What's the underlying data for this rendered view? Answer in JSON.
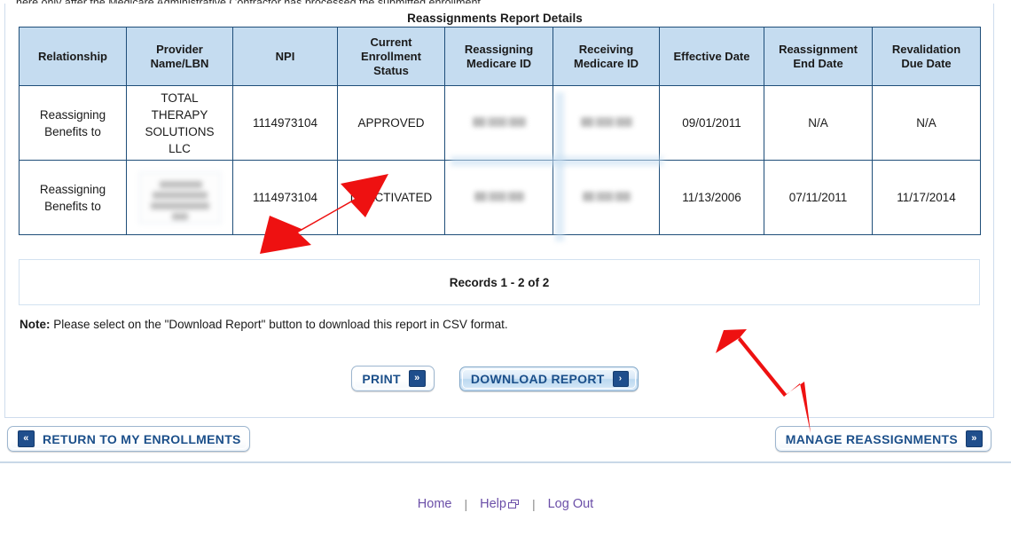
{
  "page": {
    "truncated_instruction": "here only after the Medicare Administrative Contractor has processed the submitted enrollment.",
    "report_title": "Reassignments Report Details",
    "records_label": "Records 1 - 2 of 2",
    "note_label": "Note:",
    "note_text": " Please select on the \"Download Report\" button to download this report in CSV format."
  },
  "table": {
    "headers": [
      "Relationship",
      "Provider Name/LBN",
      "NPI",
      "Current Enrollment Status",
      "Reassigning Medicare ID",
      "Receiving Medicare ID",
      "Effective Date",
      "Reassignment End Date",
      "Revalidation Due Date"
    ],
    "header_lines": [
      [
        "Relationship"
      ],
      [
        "Provider",
        "Name/LBN"
      ],
      [
        "NPI"
      ],
      [
        "Current",
        "Enrollment",
        "Status"
      ],
      [
        "Reassigning",
        "Medicare ID"
      ],
      [
        "Receiving",
        "Medicare ID"
      ],
      [
        "Effective Date"
      ],
      [
        "Reassignment",
        "End Date"
      ],
      [
        "Revalidation",
        "Due Date"
      ]
    ],
    "rows": [
      {
        "relationship": "Reassigning Benefits to",
        "relationship_lines": [
          "Reassigning",
          "Benefits to"
        ],
        "provider_name": "TOTAL THERAPY SOLUTIONS LLC",
        "provider_lines": [
          "TOTAL",
          "THERAPY",
          "SOLUTIONS",
          "LLC"
        ],
        "provider_redacted": false,
        "npi": "1114973104",
        "status": "APPROVED",
        "reassigning_medicare_id": "",
        "reassigning_redacted": true,
        "receiving_medicare_id": "",
        "receiving_redacted": true,
        "effective_date": "09/01/2011",
        "end_date": "N/A",
        "revalidation_due_date": "N/A"
      },
      {
        "relationship": "Reassigning Benefits to",
        "relationship_lines": [
          "Reassigning",
          "Benefits to"
        ],
        "provider_name": "",
        "provider_lines": [],
        "provider_redacted": true,
        "npi": "1114973104",
        "status": "DEACTIVATED",
        "reassigning_medicare_id": "",
        "reassigning_redacted": true,
        "receiving_medicare_id": "",
        "receiving_redacted": true,
        "effective_date": "11/13/2006",
        "end_date": "07/11/2011",
        "revalidation_due_date": "11/17/2014"
      }
    ]
  },
  "buttons": {
    "print": "PRINT",
    "download_report": "DOWNLOAD REPORT",
    "return_to_enrollments": "RETURN TO MY ENROLLMENTS",
    "manage_reassignments": "MANAGE REASSIGNMENTS",
    "chevron_forward": "»",
    "chevron_forward_single": "›",
    "chevron_back": "«"
  },
  "footer": {
    "links": [
      "Home",
      "Help",
      "Log Out"
    ],
    "separator": "|"
  },
  "annotations": {
    "arrow_1_target": "DEACTIVATED",
    "arrow_2_target": "MANAGE REASSIGNMENTS",
    "arrow_color": "#ee1111"
  },
  "colors": {
    "header_fill": "#c5dcf0",
    "table_border": "#1f4e79",
    "button_text": "#1b4f8a",
    "footer_link": "#6b4fa8",
    "arrow_red": "#ee1111"
  }
}
